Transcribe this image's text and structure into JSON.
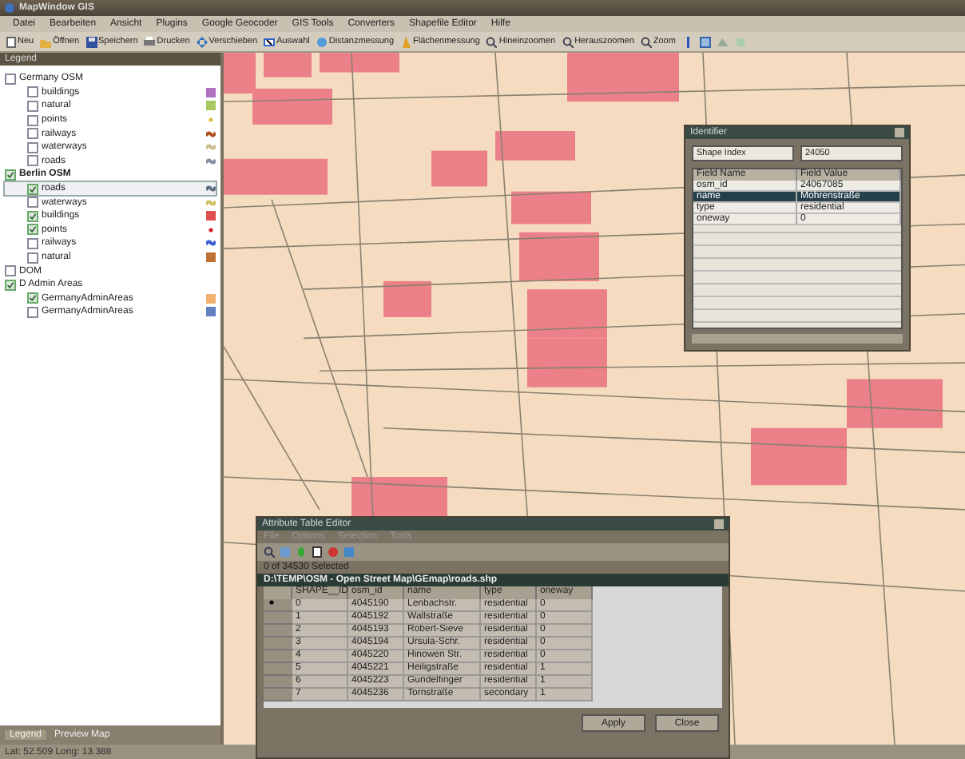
{
  "window": {
    "title": "MapWindow GIS"
  },
  "menu": [
    "Datei",
    "Bearbeiten",
    "Ansicht",
    "Plugins",
    "Google Geocoder",
    "GIS Tools",
    "Converters",
    "Shapefile Editor",
    "Hilfe"
  ],
  "toolbar": [
    {
      "label": "Neu",
      "kind": "new"
    },
    {
      "label": "Öffnen",
      "kind": "open"
    },
    {
      "label": "Speichern",
      "kind": "save"
    },
    {
      "label": "Drucken",
      "kind": "print"
    },
    {
      "label": "Verschieben",
      "kind": "pan"
    },
    {
      "label": "Auswahl",
      "kind": "select"
    },
    {
      "label": "Distanzmessung",
      "kind": "ruler"
    },
    {
      "label": "Flächenmessung",
      "kind": "area"
    },
    {
      "label": "Hineinzoomen",
      "kind": "zoomin"
    },
    {
      "label": "Herauszoomen",
      "kind": "zoomout"
    },
    {
      "label": "Zoom",
      "kind": "zoom"
    }
  ],
  "legend": {
    "title": "Legend",
    "groups": [
      {
        "label": "Germany OSM",
        "checked": false,
        "selected": false,
        "children": [
          {
            "label": "buildings",
            "checked": false,
            "selected": false,
            "kind": "fill",
            "color": "#b070c0"
          },
          {
            "label": "natural",
            "checked": false,
            "selected": false,
            "kind": "fill",
            "color": "#a8c860"
          },
          {
            "label": "points",
            "checked": false,
            "selected": false,
            "kind": "point",
            "color": "#e0c040"
          },
          {
            "label": "railways",
            "checked": false,
            "selected": false,
            "kind": "line",
            "color": "#b05020"
          },
          {
            "label": "waterways",
            "checked": false,
            "selected": false,
            "kind": "line",
            "color": "#c8c090"
          },
          {
            "label": "roads",
            "checked": false,
            "selected": false,
            "kind": "line",
            "color": "#8090a0"
          }
        ]
      },
      {
        "label": "Berlin OSM",
        "checked": true,
        "selected": true,
        "children": [
          {
            "label": "roads",
            "checked": true,
            "selected": true,
            "kind": "line",
            "color": "#607080"
          },
          {
            "label": "waterways",
            "checked": false,
            "selected": false,
            "kind": "line",
            "color": "#d0c060"
          },
          {
            "label": "buildings",
            "checked": true,
            "selected": false,
            "kind": "fill",
            "color": "#e05050"
          },
          {
            "label": "points",
            "checked": true,
            "selected": false,
            "kind": "point",
            "color": "#d02020"
          },
          {
            "label": "railways",
            "checked": false,
            "selected": false,
            "kind": "line",
            "color": "#4060d0"
          },
          {
            "label": "natural",
            "checked": false,
            "selected": false,
            "kind": "fill",
            "color": "#c07030"
          }
        ]
      },
      {
        "label": "DOM",
        "checked": false,
        "selected": false
      },
      {
        "label": "D Admin Areas",
        "checked": true,
        "selected": false,
        "children": [
          {
            "label": "GermanyAdminAreas",
            "checked": true,
            "selected": false,
            "kind": "fill",
            "color": "#f0b070"
          },
          {
            "label": "GermanyAdminAreas",
            "checked": false,
            "selected": false,
            "kind": "fill",
            "color": "#6080c0"
          }
        ]
      }
    ],
    "tabs": [
      {
        "label": "Legend",
        "selected": true
      },
      {
        "label": "Preview Map",
        "selected": false
      }
    ]
  },
  "status_bar": "Lat: 52.509 Long: 13.388",
  "identifier": {
    "title": "Identifier",
    "layer": "Shape Index",
    "shape": "24050",
    "columns": [
      "Field Name",
      "Field Value"
    ],
    "rows": [
      {
        "field": "osm_id",
        "value": "24067085",
        "selected": false
      },
      {
        "field": "name",
        "value": "Mohrenstraße",
        "selected": true
      },
      {
        "field": "type",
        "value": "residential",
        "selected": false
      },
      {
        "field": "oneway",
        "value": "0",
        "selected": false
      }
    ]
  },
  "attribute_table": {
    "title": "Attribute Table Editor",
    "menu": [
      "File",
      "Options",
      "Selection",
      "Tools"
    ],
    "selection": "0 of 34530 Selected",
    "path": "D:\\TEMP\\OSM - Open Street Map\\GEmap\\roads.shp",
    "columns": [
      "SHAPE__ID",
      "osm_id",
      "name",
      "type",
      "oneway"
    ],
    "rows": [
      {
        "cells": [
          "0",
          "4045190",
          "Lenbachstr.",
          "residential",
          "0"
        ],
        "selected": true
      },
      {
        "cells": [
          "1",
          "4045192",
          "Wallstraße",
          "residential",
          "0"
        ],
        "selected": false
      },
      {
        "cells": [
          "2",
          "4045193",
          "Robert-Sieve",
          "residential",
          "0"
        ],
        "selected": false
      },
      {
        "cells": [
          "3",
          "4045194",
          "Ursula-Schr.",
          "residential",
          "0"
        ],
        "selected": false
      },
      {
        "cells": [
          "4",
          "4045220",
          "Hinowen Str.",
          "residential",
          "0"
        ],
        "selected": false
      },
      {
        "cells": [
          "5",
          "4045221",
          "Heiligstraße",
          "residential",
          "1"
        ],
        "selected": false
      },
      {
        "cells": [
          "6",
          "4045223",
          "Gundelfinger",
          "residential",
          "1"
        ],
        "selected": false
      },
      {
        "cells": [
          "7",
          "4045236",
          "Tornstraße",
          "secondary",
          "1"
        ],
        "selected": false
      }
    ],
    "buttons": [
      "Apply",
      "Close"
    ]
  }
}
